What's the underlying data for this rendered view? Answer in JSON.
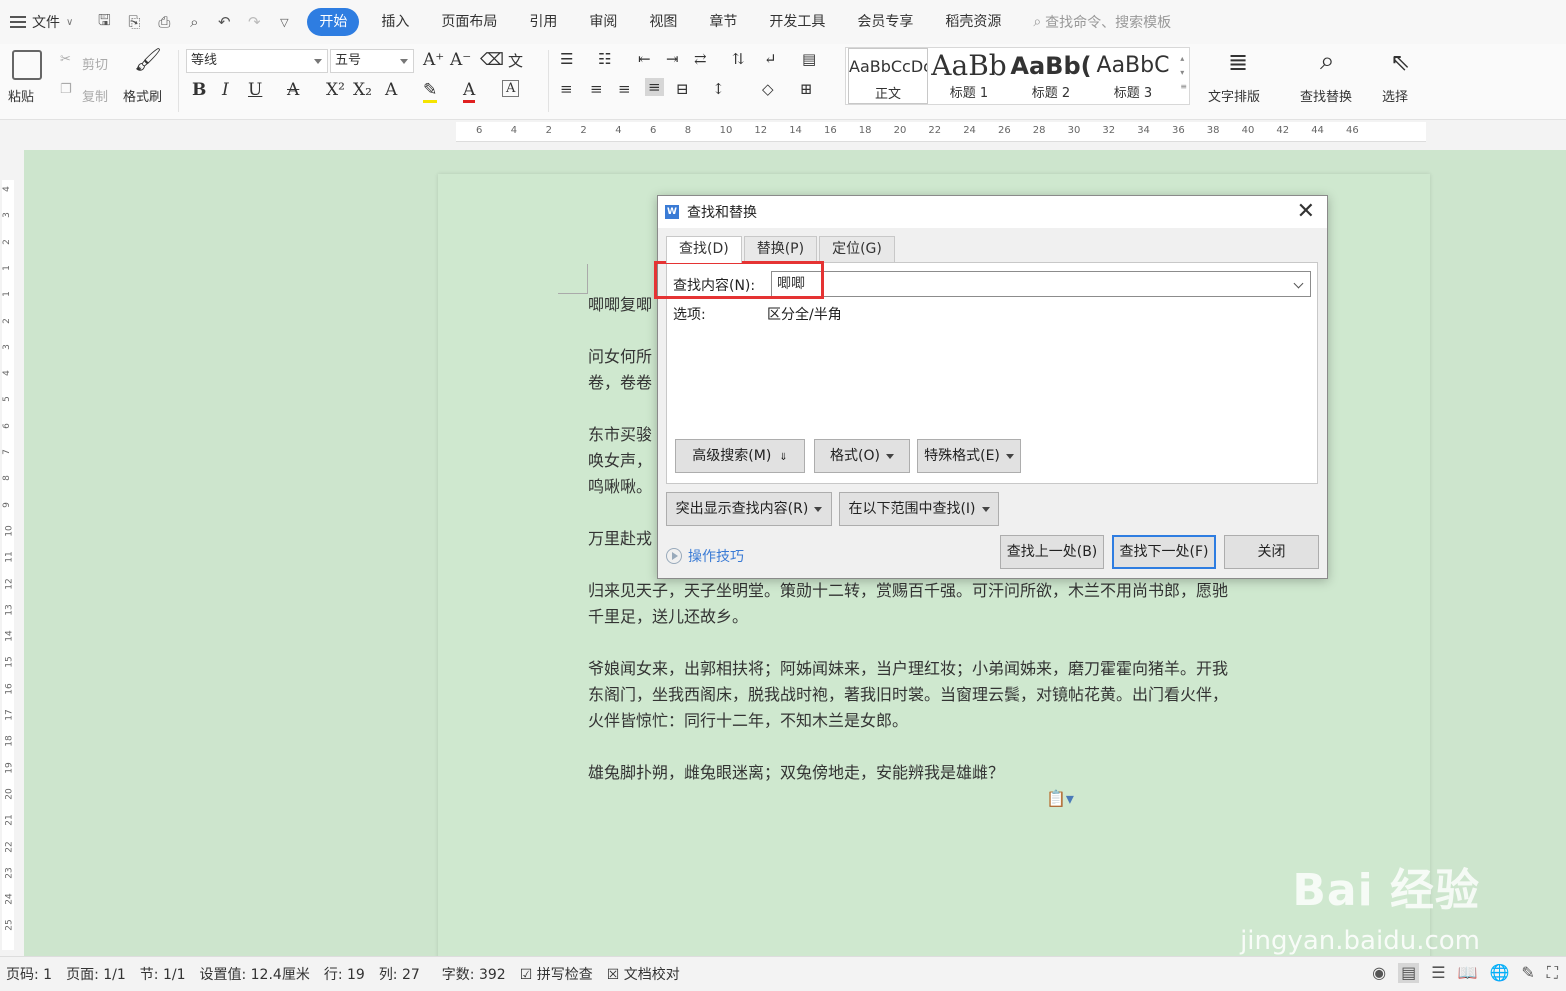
{
  "menubar": {
    "file": "文件",
    "menus": [
      "开始",
      "插入",
      "页面布局",
      "引用",
      "审阅",
      "视图",
      "章节",
      "开发工具",
      "会员专享",
      "稻壳资源"
    ],
    "active_index": 0,
    "search_placeholder": "查找命令、搜索模板"
  },
  "ribbon": {
    "paste": "粘贴",
    "cut": "剪切",
    "copy": "复制",
    "format_painter": "格式刷",
    "font_name": "等线",
    "font_size": "五号",
    "styles": [
      {
        "preview": "AaBbCcDc",
        "name": "正文"
      },
      {
        "preview": "AaBb",
        "name": "标题 1"
      },
      {
        "preview": "AaBb(",
        "name": "标题 2"
      },
      {
        "preview": "AaBbC",
        "name": "标题 3"
      }
    ],
    "text_layout": "文字排版",
    "find_replace": "查找替换",
    "select": "选择"
  },
  "ruler": {
    "h_ticks": [
      "6",
      "4",
      "2",
      "2",
      "4",
      "6",
      "8",
      "10",
      "12",
      "14",
      "16",
      "18",
      "20",
      "22",
      "24",
      "26",
      "28",
      "30",
      "32",
      "34",
      "36",
      "38",
      "40",
      "42",
      "44",
      "46"
    ],
    "v_ticks": [
      "4",
      "3",
      "2",
      "1",
      "1",
      "2",
      "3",
      "4",
      "5",
      "6",
      "7",
      "8",
      "9",
      "10",
      "11",
      "12",
      "13",
      "14",
      "15",
      "16",
      "17",
      "18",
      "19",
      "20",
      "21",
      "22",
      "23",
      "24",
      "25"
    ]
  },
  "document": {
    "paragraphs": [
      "唧唧复唧",
      "问女何所\n卷，卷卷",
      "东市买骏\n唤女声，\n鸣啾啾。",
      "万里赴戎",
      "归来见天子，天子坐明堂。策勋十二转，赏赐百千强。可汗问所欲，木兰不用尚书郎，愿驰\n千里足，送儿还故乡。",
      "爷娘闻女来，出郭相扶将；阿姊闻妹来，当户理红妆；小弟闻姊来，磨刀霍霍向猪羊。开我\n东阁门，坐我西阁床，脱我战时袍，著我旧时裳。当窗理云鬓，对镜帖花黄。出门看火伴，\n火伴皆惊忙：同行十二年，不知木兰是女郎。",
      "雄兔脚扑朔，雌兔眼迷离；双兔傍地走，安能辨我是雄雌？"
    ]
  },
  "dialog": {
    "title": "查找和替换",
    "tabs": [
      "查找(D)",
      "替换(P)",
      "定位(G)"
    ],
    "find_label": "查找内容(N):",
    "find_value": "唧唧",
    "options_label": "选项:",
    "options_value": "区分全/半角",
    "advanced_search": "高级搜索(M)",
    "format": "格式(O)",
    "special_format": "特殊格式(E)",
    "highlight_found": "突出显示查找内容(R)",
    "find_in": "在以下范围中查找(I)",
    "tips": "操作技巧",
    "find_prev": "查找上一处(B)",
    "find_next": "查找下一处(F)",
    "close": "关闭"
  },
  "statusbar": {
    "page_num": "页码: 1",
    "pages": "页面: 1/1",
    "section": "节: 1/1",
    "setting": "设置值: 12.4厘米",
    "row": "行: 19",
    "col": "列: 27",
    "word_count": "字数: 392",
    "spell_check": "拼写检查",
    "doc_proof": "文档校对"
  },
  "watermark": {
    "brand": "Bai 经验",
    "url": "jingyan.baidu.com"
  }
}
